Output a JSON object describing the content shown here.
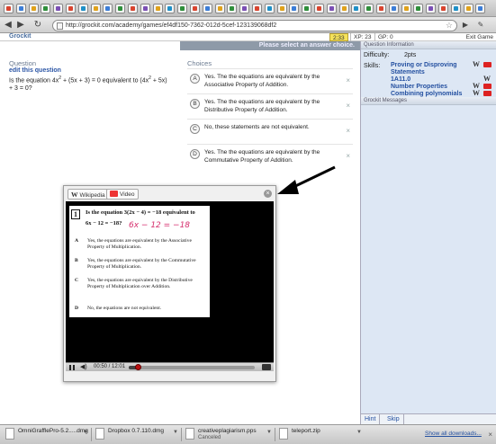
{
  "browser": {
    "url": "http://grockit.com/academy/games/ef4df150-7362-012d-5cef-123139068df2",
    "tab_colors": [
      "#d9442f",
      "#3b7dd8",
      "#e0a21b",
      "#2f8f3b",
      "#7b4fb5",
      "#d9442f",
      "#1e90c8",
      "#e0a21b",
      "#3b7dd8",
      "#2f8f3b",
      "#d9442f",
      "#7b4fb5",
      "#e0a21b",
      "#1e90c8",
      "#2f8f3b",
      "#d9442f",
      "#3b7dd8",
      "#e0a21b",
      "#2f8f3b",
      "#7b4fb5",
      "#d9442f",
      "#1e90c8",
      "#e0a21b",
      "#3b7dd8",
      "#2f8f3b",
      "#d9442f",
      "#7b4fb5",
      "#e0a21b",
      "#1e90c8",
      "#2f8f3b",
      "#d9442f",
      "#3b7dd8",
      "#e0a21b",
      "#2f8f3b",
      "#7b4fb5",
      "#d9442f",
      "#1e90c8",
      "#e0a21b",
      "#3b7dd8"
    ]
  },
  "app": {
    "logo": "Grockit",
    "timer": "2:33",
    "xp": "XP: 23",
    "gp": "GP: 0",
    "exit": "Exit Game",
    "prompt": "Please select an answer choice."
  },
  "question": {
    "title": "Question",
    "edit": "edit this question",
    "line1a": "Is the equation 4x",
    "sup1": "2",
    "line1b": " + (5x + 3) = 0 equivalent to (4x",
    "sup2": "2",
    "line1c": " + 5x)",
    "line2": "+ 3 = 0?"
  },
  "choices": {
    "title": "Choices",
    "items": [
      {
        "letter": "A",
        "text": "Yes. The the equations are equivalent by the Associative Property of Addition."
      },
      {
        "letter": "B",
        "text": "Yes. The the equations are equivalent by the Distributive Property of Addition."
      },
      {
        "letter": "C",
        "text": "No, these statements are not equivalent."
      },
      {
        "letter": "D",
        "text": "Yes. The the equations are equivalent by the Commutative Property of Addition."
      }
    ]
  },
  "popup": {
    "tab_wikipedia": "Wikipedia",
    "tab_video": "Video",
    "close": "×",
    "paper": {
      "number": "1",
      "line1": "Is the equation 3(2x − 4) = −18 equivalent to",
      "line2": "6x − 12 = −18?",
      "handwriting": "6x − 12 = −18",
      "choices": [
        {
          "letter": "A",
          "text": "Yes, the equations are equivalent by the Associative Property of Multiplication."
        },
        {
          "letter": "B",
          "text": "Yes, the equations are equivalent by the Commutative Property of Multiplication."
        },
        {
          "letter": "C",
          "text": "Yes, the equations are equivalent by the Distributive Property of Multiplication over Addition."
        },
        {
          "letter": "D",
          "text": "No, the equations are not equivalent."
        }
      ]
    },
    "controls": {
      "time": "00:50 / 12:01",
      "progress": 0.069
    }
  },
  "sidebar": {
    "info_header": "Question Information",
    "difficulty_label": "Difficulty:",
    "difficulty_value": "2pts",
    "skills_label": "Skills:",
    "skills": [
      "Proving or Disproving",
      "Statements",
      "1A11.0",
      "Number Properties",
      "Combining polynomials"
    ],
    "messages_header": "Grockit Messages",
    "tab_hint": "Hint",
    "tab_skip": "Skip"
  },
  "downloads": {
    "items": [
      {
        "name": "OmniGrafflePro-5.2.....dmg",
        "status": ""
      },
      {
        "name": "Dropbox 0.7.110.dmg",
        "status": ""
      },
      {
        "name": "creativeplagiarism.pps",
        "status": "Canceled"
      },
      {
        "name": "teleport.zip",
        "status": ""
      }
    ],
    "show_all": "Show all downloads..."
  }
}
